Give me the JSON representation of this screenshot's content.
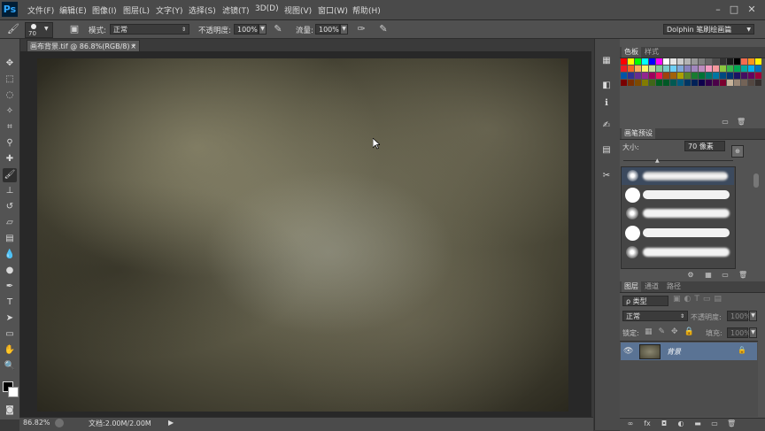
{
  "app": {
    "logo": "Ps"
  },
  "menu": [
    "文件(F)",
    "编辑(E)",
    "图像(I)",
    "图层(L)",
    "文字(Y)",
    "选择(S)",
    "滤镜(T)",
    "3D(D)",
    "视图(V)",
    "窗口(W)",
    "帮助(H)"
  ],
  "window_controls": [
    "–",
    "□",
    "✕"
  ],
  "options": {
    "brush_size": "70",
    "mode_label": "模式:",
    "mode_value": "正常",
    "opacity_label": "不透明度:",
    "opacity_value": "100%",
    "flow_label": "流量:",
    "flow_value": "100%",
    "workspace": "Dolphin 笔刷绘画篇"
  },
  "document": {
    "tab_title": "画布背景.tif @ 86.8%(RGB/8) *",
    "close": "×"
  },
  "status": {
    "zoom": "86.82%",
    "doc_info": "文档:2.00M/2.00M"
  },
  "swatches_panel": {
    "tabs": [
      "色板",
      "样式"
    ],
    "colors": [
      "#ff0000",
      "#ffff00",
      "#00ff00",
      "#00ffff",
      "#0000ff",
      "#ff00ff",
      "#ffffff",
      "#e6e6e6",
      "#cccccc",
      "#b3b3b3",
      "#999999",
      "#808080",
      "#666666",
      "#4d4d4d",
      "#333333",
      "#1a1a1a",
      "#000000",
      "#f26c4f",
      "#f7941d",
      "#fff200",
      "#ed1c24",
      "#f26522",
      "#fbaf5d",
      "#fff568",
      "#c4df9b",
      "#82ca9c",
      "#7accc8",
      "#6dcff6",
      "#7ea7d8",
      "#8781bd",
      "#a186be",
      "#bd8cbf",
      "#f49ac1",
      "#f5989d",
      "#8dc63f",
      "#39b54a",
      "#00a651",
      "#00a99d",
      "#00aeef",
      "#0072bc",
      "#0054a6",
      "#2e3192",
      "#662d91",
      "#92278f",
      "#9e005d",
      "#ed145b",
      "#a0410d",
      "#a3620a",
      "#aba000",
      "#598527",
      "#197b30",
      "#007236",
      "#00746b",
      "#0076a3",
      "#004a80",
      "#003471",
      "#1b1464",
      "#440e62",
      "#630460",
      "#9e0039",
      "#790000",
      "#7b2e00",
      "#7d4900",
      "#827b00",
      "#406618",
      "#005e20",
      "#005826",
      "#005952",
      "#005b7f",
      "#003663",
      "#002157",
      "#0d004c",
      "#32004b",
      "#4b0049",
      "#7b002e",
      "#c7b299",
      "#998675",
      "#736357",
      "#534741",
      "#362f2d"
    ]
  },
  "brush_panel": {
    "tabs": [
      "画笔预设"
    ],
    "size_label": "大小:",
    "size_value": "70 像素"
  },
  "layers_panel": {
    "tabs": [
      "图层",
      "通道",
      "路径"
    ],
    "filter_label": "ρ 类型",
    "blend_mode": "正常",
    "opacity_label": "不透明度:",
    "opacity_value": "100%",
    "lock_label": "锁定:",
    "fill_label": "填充:",
    "fill_value": "100%",
    "layers": [
      {
        "name": "背景",
        "locked": true,
        "visible": true
      }
    ]
  }
}
